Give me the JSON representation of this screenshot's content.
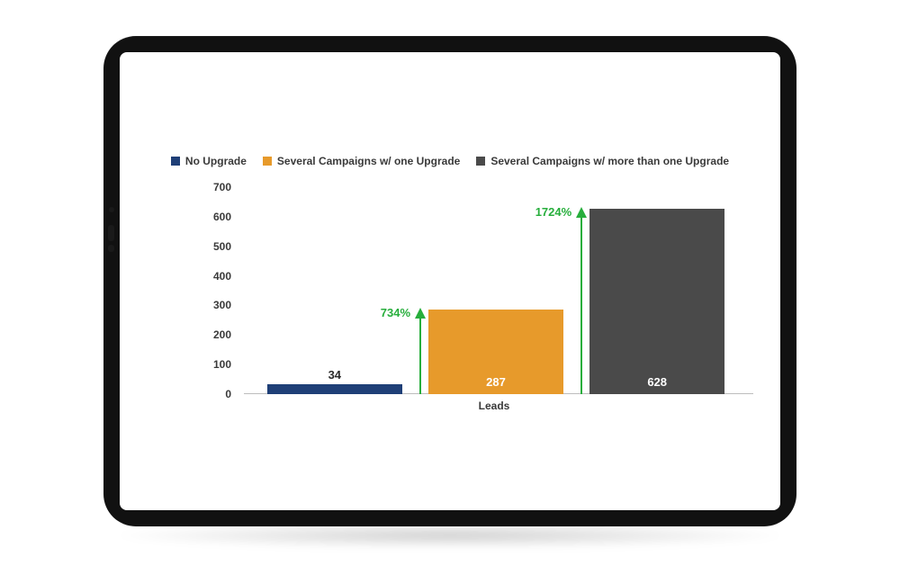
{
  "chart_data": {
    "type": "bar",
    "categories": [
      "No Upgrade",
      "Several Campaigns w/ one Upgrade",
      "Several Campaigns w/ more than one Upgrade"
    ],
    "values": [
      34,
      287,
      628
    ],
    "xlabel": "Leads",
    "ylabel": "",
    "ylim": [
      0,
      700
    ],
    "y_ticks": [
      0,
      100,
      200,
      300,
      400,
      500,
      600,
      700
    ],
    "series_colors": [
      "#1f3f77",
      "#e79a2b",
      "#4a4a4a"
    ],
    "annotations": [
      {
        "text": "734%",
        "applies_to_index": 1
      },
      {
        "text": "1724%",
        "applies_to_index": 2
      }
    ],
    "value_label_position": [
      "above",
      "inside",
      "inside"
    ]
  },
  "legend": {
    "items": [
      {
        "label": "No Upgrade",
        "color": "#1f3f77"
      },
      {
        "label": "Several Campaigns w/ one Upgrade",
        "color": "#e79a2b"
      },
      {
        "label": "Several Campaigns w/ more than one Upgrade",
        "color": "#4a4a4a"
      }
    ]
  },
  "colors": {
    "accent_green": "#27ae3c"
  }
}
